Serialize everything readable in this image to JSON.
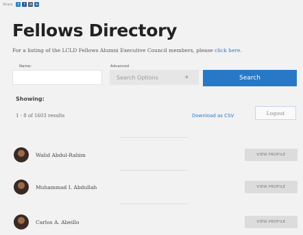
{
  "share": {
    "label": "Share",
    "icons": [
      {
        "name": "twitter",
        "glyph": "t",
        "color": "#2d84c6"
      },
      {
        "name": "facebook",
        "glyph": "f",
        "color": "#2d5a98"
      },
      {
        "name": "email",
        "glyph": "✉",
        "color": "#4d5a66"
      },
      {
        "name": "linkedin",
        "glyph": "in",
        "color": "#1f6aa8"
      }
    ]
  },
  "title": "Fellows Directory",
  "intro": {
    "text": "For a listing of the LCLD Fellows Alumni Executive Council members, please ",
    "link": "click here."
  },
  "search": {
    "name_label": "Name:",
    "name_value": "",
    "advanced_label": "Advanced",
    "advanced_placeholder": "Search Options",
    "advanced_icon": "plus-icon",
    "search_button": "Search"
  },
  "results": {
    "showing_label": "Showing:",
    "range_text": "1 - 8 of 1603 results",
    "download_label": "Download as CSV",
    "logout_label": "Logout"
  },
  "fellows": [
    {
      "name": "Walid Abdul-Rahim",
      "button": "VIEW PROFILE"
    },
    {
      "name": "Muhammad I. Abdullah",
      "button": "VIEW PROFILE"
    },
    {
      "name": "Carlos A. Abeillo",
      "button": "VIEW PROFILE"
    }
  ],
  "colors": {
    "accent": "#2878c8",
    "link": "#2a79c8",
    "background": "#f2f2f2"
  }
}
